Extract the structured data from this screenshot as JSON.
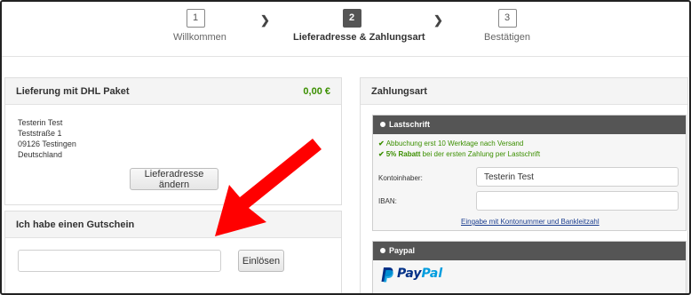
{
  "stepper": {
    "steps": [
      {
        "num": "1",
        "label": "Willkommen"
      },
      {
        "num": "2",
        "label": "Lieferadresse & Zahlungsart"
      },
      {
        "num": "3",
        "label": "Bestätigen"
      }
    ]
  },
  "delivery": {
    "title": "Lieferung mit DHL Paket",
    "price": "0,00 €",
    "address": [
      "Testerin Test",
      "Teststraße 1",
      "09126 Testingen",
      "Deutschland"
    ],
    "change_button": "Lieferadresse ändern"
  },
  "voucher": {
    "title": "Ich habe einen Gutschein",
    "input_value": "",
    "redeem_button": "Einlösen"
  },
  "payment": {
    "title": "Zahlungsart",
    "lastschrift": {
      "title": "Lastschrift",
      "note1": "Abbuchung erst 10 Werktage nach Versand",
      "note2_bold": "5% Rabatt",
      "note2_rest": " bei der ersten Zahlung per Lastschrift",
      "owner_label": "Kontoinhaber:",
      "owner_value": "Testerin Test",
      "iban_label": "IBAN:",
      "iban_value": "",
      "alt_link": "Eingabe mit Kontonummer und Bankleitzahl"
    },
    "paypal": {
      "title": "Paypal",
      "logo_pay": "Pay",
      "logo_pal": "Pal"
    }
  },
  "colors": {
    "accent_green": "#3b8f00",
    "arrow_red": "#ff0000",
    "paypal_dark": "#003087",
    "paypal_light": "#009cde"
  }
}
